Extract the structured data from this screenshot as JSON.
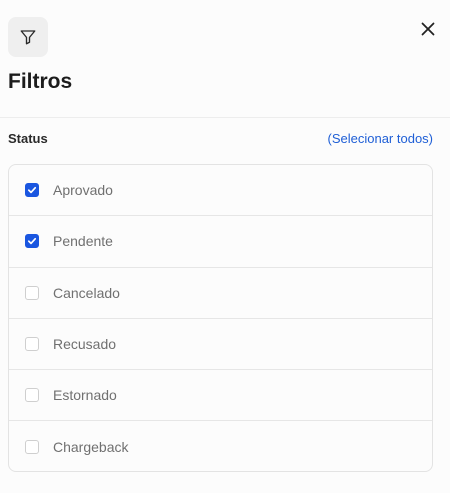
{
  "header": {
    "title": "Filtros",
    "filter_icon": "filter-icon",
    "close_icon": "close-icon"
  },
  "status_section": {
    "label": "Status",
    "select_all_label": "(Selecionar todos)",
    "options": [
      {
        "label": "Aprovado",
        "checked": true
      },
      {
        "label": "Pendente",
        "checked": true
      },
      {
        "label": "Cancelado",
        "checked": false
      },
      {
        "label": "Recusado",
        "checked": false
      },
      {
        "label": "Estornado",
        "checked": false
      },
      {
        "label": "Chargeback",
        "checked": false
      }
    ]
  },
  "colors": {
    "accent": "#1a56e0",
    "link": "#1f5fd6",
    "title": "#1c1c1c",
    "option_text": "#707070"
  }
}
